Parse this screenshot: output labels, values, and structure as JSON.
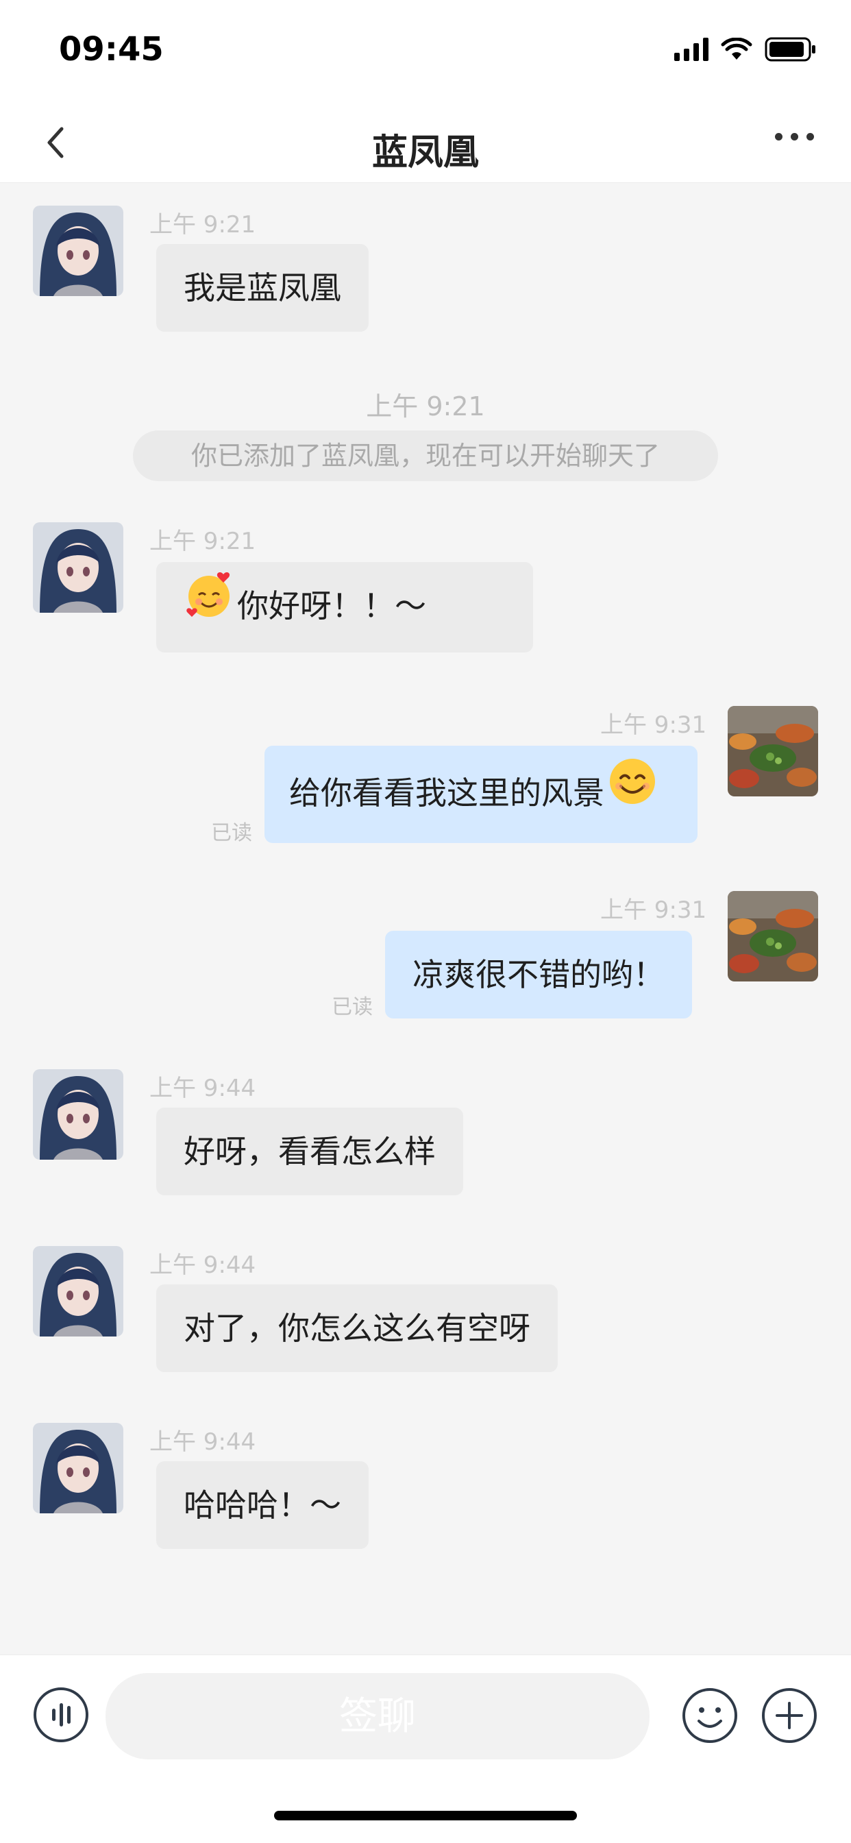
{
  "status_bar": {
    "time": "09:45"
  },
  "header": {
    "title": "蓝凤凰"
  },
  "messages": [
    {
      "time": "上午 9:21",
      "text": "我是蓝凤凰"
    },
    {
      "time": "上午 9:21",
      "text": "你好呀！！～"
    },
    {
      "time": "上午 9:31",
      "text": "给你看看我这里的风景",
      "read": "已读"
    },
    {
      "time": "上午 9:31",
      "text": "凉爽很不错的哟！",
      "read": "已读"
    },
    {
      "time": "上午 9:44",
      "text": "好呀，看看怎么样"
    },
    {
      "time": "上午 9:44",
      "text": "对了，你怎么这么有空呀"
    },
    {
      "time": "上午 9:44",
      "text": "哈哈哈！～"
    }
  ],
  "system": {
    "time": "上午 9:21",
    "notice": "你已添加了蓝凤凰，现在可以开始聊天了"
  },
  "input": {
    "placeholder": "签聊"
  },
  "colors": {
    "incoming_bubble": "#ebebeb",
    "outgoing_bubble": "#d5e9ff",
    "background": "#f5f5f5"
  },
  "icons": [
    "signal-icon",
    "wifi-icon",
    "battery-icon",
    "back-arrow-icon",
    "more-dots-icon",
    "voice-icon",
    "emoji-icon",
    "plus-icon"
  ]
}
